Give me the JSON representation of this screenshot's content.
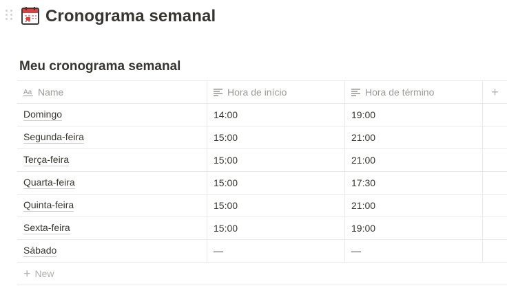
{
  "page": {
    "title": "Cronograma semanal",
    "icon": "calendar-icon"
  },
  "database": {
    "title": "Meu cronograma semanal",
    "columns": [
      {
        "label": "Name",
        "icon": "text-type-icon"
      },
      {
        "label": "Hora de início",
        "icon": "text-lines-icon"
      },
      {
        "label": "Hora de término",
        "icon": "text-lines-icon"
      }
    ],
    "add_column_label": "+",
    "rows": [
      {
        "name": "Domingo",
        "start": "14:00",
        "end": "19:00"
      },
      {
        "name": "Segunda-feira",
        "start": "15:00",
        "end": "21:00"
      },
      {
        "name": "Terça-feira",
        "start": "15:00",
        "end": "21:00"
      },
      {
        "name": "Quarta-feira",
        "start": "15:00",
        "end": "17:30"
      },
      {
        "name": "Quinta-feira",
        "start": "15:00",
        "end": "21:00"
      },
      {
        "name": "Sexta-feira",
        "start": "15:00",
        "end": "19:00"
      },
      {
        "name": "Sábado",
        "start": "—",
        "end": "—"
      }
    ],
    "new_label": "New"
  },
  "colors": {
    "text": "#37352f",
    "muted": "#9b9a97",
    "border": "#e9e9e7",
    "icon_red": "#e03e3e"
  }
}
